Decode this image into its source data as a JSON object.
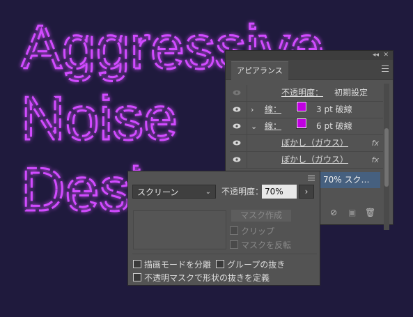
{
  "canvas": {
    "lines": [
      "Aggressive",
      "Noise",
      "Desi"
    ],
    "stroke_color": "#d14bff"
  },
  "appearance": {
    "tab": "アピアランス",
    "rows": [
      {
        "label": "不透明度：",
        "value": "初期設定",
        "dim_eye": true
      },
      {
        "label": "線：",
        "value": "3 pt 破線",
        "chevron": "›"
      },
      {
        "label": "線：",
        "value": "6 pt 破線",
        "chevron": "⌄"
      },
      {
        "label": "ぼかし（ガウス）",
        "fx": "fx"
      },
      {
        "label": "ぼかし（ガウス）",
        "fx": "fx"
      }
    ],
    "selected_row": "70% スク…",
    "footer": [
      "⊘",
      "▣",
      "🗑"
    ]
  },
  "transparency": {
    "blend_mode": "スクリーン",
    "opacity_label": "不透明度：",
    "opacity_value": "70%",
    "mask_button": "マスク作成",
    "clip": "クリップ",
    "invert_mask": "マスクを反転",
    "isolate_blending": "描画モードを分離",
    "knockout_group": "グループの抜き",
    "opacity_mask_define": "不透明マスクで形状の抜きを定義"
  }
}
